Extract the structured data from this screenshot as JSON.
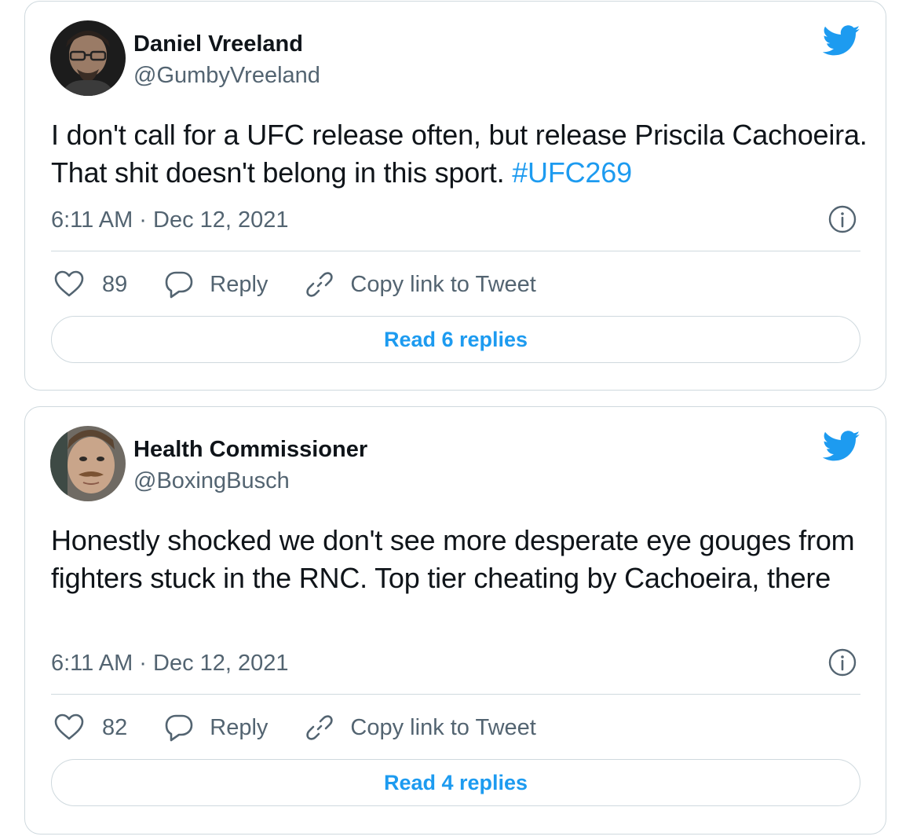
{
  "colors": {
    "text_primary": "#0f1419",
    "text_secondary": "#536471",
    "accent_blue": "#1d9bf0",
    "border": "#cfd9de"
  },
  "tweets": [
    {
      "author": {
        "display_name": "Daniel Vreeland",
        "handle": "@GumbyVreeland",
        "avatar": "avatar-photo-man-glasses"
      },
      "text": "I don't call for a UFC release often, but release Priscila Cachoeira. That shit doesn't belong in this sport. ",
      "hashtag": "#UFC269",
      "timestamp": "6:11 AM · Dec 12, 2021",
      "like_count": "89",
      "reply_label": "Reply",
      "copy_link_label": "Copy link to Tweet",
      "read_replies_label": "Read 6 replies",
      "icons": [
        "twitter-bird-icon",
        "info-icon",
        "heart-icon",
        "reply-bubble-icon",
        "link-icon"
      ]
    },
    {
      "author": {
        "display_name": "Health Commissioner",
        "handle": "@BoxingBusch",
        "avatar": "avatar-photo-man-mustache"
      },
      "text": "Honestly shocked we don't see more desperate eye gouges from fighters stuck in the RNC. Top tier cheating by Cachoeira, there",
      "timestamp": "6:11 AM · Dec 12, 2021",
      "like_count": "82",
      "reply_label": "Reply",
      "copy_link_label": "Copy link to Tweet",
      "read_replies_label": "Read 4 replies",
      "icons": [
        "twitter-bird-icon",
        "info-icon",
        "heart-icon",
        "reply-bubble-icon",
        "link-icon"
      ]
    }
  ]
}
